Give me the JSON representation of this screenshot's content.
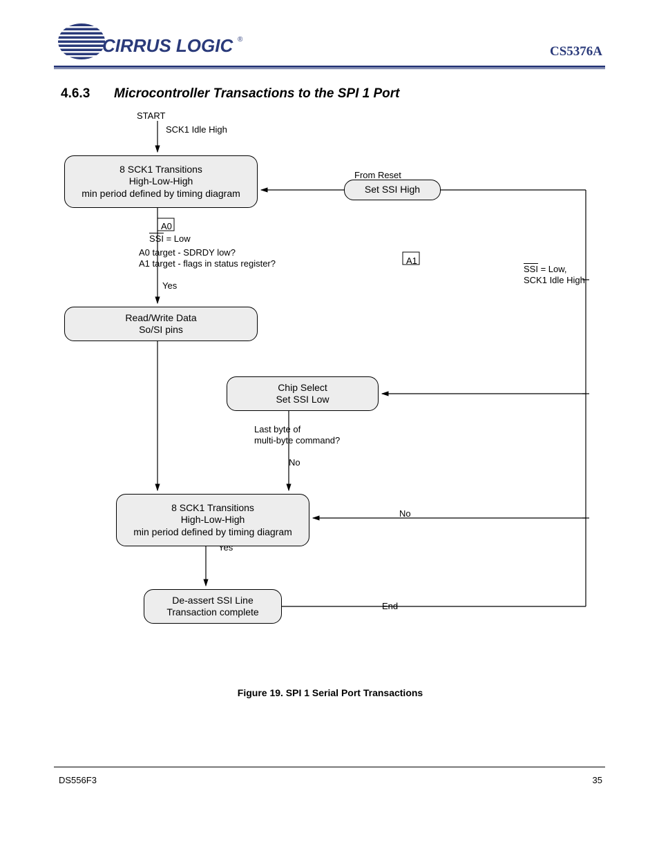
{
  "header": {
    "product": "CS5376A"
  },
  "section": {
    "number": "4.6.3",
    "title": "Microcontroller Transactions to the SPI 1 Port"
  },
  "labels": {
    "start_label": "START",
    "sck_idle": "SCK1 Idle High",
    "ssi_label_1": "SSI",
    "ssi_low": "= Low",
    "a0_sdrdy": "A0 target - SDRDY low?\nA1 target - flags in status register?",
    "yes": "Yes",
    "from_reset": "From Reset",
    "ssi2_1": "SSI",
    "ssi2_low": "= Low,\nSCK1 Idle High",
    "last_byte": "Last byte of\nmulti-byte command?",
    "no": "No"
  },
  "nodes": {
    "sck_transitions": "8 SCK1 Transitions\nHigh-Low-High\nmin period defined by timing diagram",
    "set_ssi_high": "Set SSI High",
    "readwrite": "Read/Write Data\nSo/SI pins",
    "chip_select": "Chip Select\nSet SSI Low",
    "deassert": "De-assert SSI Line\nTransaction complete",
    "end": "End"
  },
  "figure": {
    "caption": "Figure 19.  SPI 1 Serial Port Transactions"
  },
  "footer": {
    "left": "DS556F3",
    "right": "35"
  }
}
